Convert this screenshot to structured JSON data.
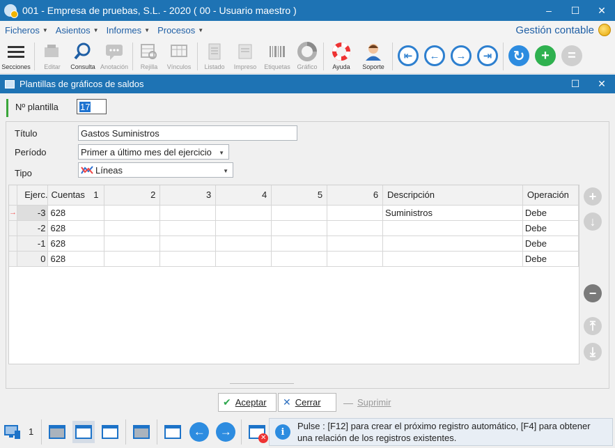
{
  "window": {
    "title": "001 - Empresa de pruebas, S.L. - 2020 ( 00 - Usuario maestro )",
    "minimize": "–",
    "maximize": "☐",
    "close": "✕"
  },
  "menu": {
    "items": [
      {
        "label": "Ficheros"
      },
      {
        "label": "Asientos"
      },
      {
        "label": "Informes"
      },
      {
        "label": "Procesos"
      }
    ],
    "module": "Gestión contable"
  },
  "toolbar": {
    "buttons": [
      {
        "label": "Secciones",
        "icon": "hamburger-icon"
      },
      {
        "label": "Editar",
        "icon": "edit-icon"
      },
      {
        "label": "Consulta",
        "icon": "magnifier-icon"
      },
      {
        "label": "Anotación",
        "icon": "note-icon"
      },
      {
        "label": "Rejilla",
        "icon": "grid-icon"
      },
      {
        "label": "Vínculos",
        "icon": "links-icon"
      },
      {
        "label": "Listado",
        "icon": "listing-icon"
      },
      {
        "label": "Impreso",
        "icon": "print-icon"
      },
      {
        "label": "Etiquetas",
        "icon": "barcode-icon"
      },
      {
        "label": "Gráfico",
        "icon": "chart-icon"
      },
      {
        "label": "Ayuda",
        "icon": "lifebuoy-icon"
      },
      {
        "label": "Soporte",
        "icon": "support-icon"
      }
    ]
  },
  "dialog": {
    "title": "Plantillas de gráficos de saldos",
    "maximize": "☐",
    "close": "✕",
    "plantilla_label": "Nº plantilla",
    "plantilla_value": "17",
    "titulo_label": "Título",
    "titulo_value": "Gastos Suministros",
    "periodo_label": "Período",
    "periodo_value": "Primer a último mes del ejercicio",
    "tipo_label": "Tipo",
    "tipo_value": "Líneas"
  },
  "grid": {
    "columns": [
      "Ejerc.",
      "Cuentas",
      "1",
      "2",
      "3",
      "4",
      "5",
      "6",
      "Descripción",
      "Operación"
    ],
    "rows": [
      {
        "ejerc": "-3",
        "cuenta": "628",
        "descripcion": "Suministros",
        "operacion": "Debe"
      },
      {
        "ejerc": "-2",
        "cuenta": "628",
        "descripcion": "",
        "operacion": "Debe"
      },
      {
        "ejerc": "-1",
        "cuenta": "628",
        "descripcion": "",
        "operacion": "Debe"
      },
      {
        "ejerc": "0",
        "cuenta": "628",
        "descripcion": "",
        "operacion": "Debe"
      }
    ]
  },
  "buttons": {
    "aceptar": "Aceptar",
    "cerrar": "Cerrar",
    "suprimir": "Suprimir"
  },
  "taskbar": {
    "count": "1"
  },
  "status": {
    "line1": "Pulse :  [F12] para crear el próximo registro automático, [F4] para obtener",
    "line2": "una relación de los registros existentes."
  },
  "colors": {
    "titlebar": "#1e73b4",
    "accent": "#2d7fcf",
    "add_green": "#2fb14f"
  }
}
